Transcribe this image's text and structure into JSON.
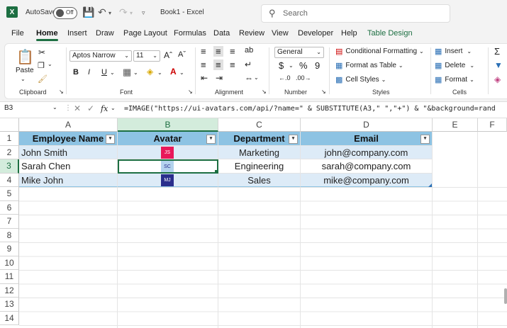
{
  "app": {
    "logo": "X",
    "autosave_label": "AutoSave",
    "autosave_state": "Off",
    "doc_title": "Book1  -  Excel"
  },
  "search": {
    "placeholder": "Search"
  },
  "tabs": [
    "File",
    "Home",
    "Insert",
    "Draw",
    "Page Layout",
    "Formulas",
    "Data",
    "Review",
    "View",
    "Developer",
    "Help",
    "Table Design"
  ],
  "ribbon": {
    "clipboard": {
      "paste_label": "Paste",
      "group_label": "Clipboard"
    },
    "font": {
      "font_name": "Aptos Narrow",
      "font_size": "11",
      "group_label": "Font",
      "bold": "B",
      "italic": "I",
      "underline": "U"
    },
    "alignment": {
      "group_label": "Alignment"
    },
    "number": {
      "format": "General",
      "currency": "$",
      "percent": "%",
      "comma": "9",
      "group_label": "Number"
    },
    "styles": {
      "conditional": "Conditional Formatting",
      "format_table": "Format as Table",
      "cell_styles": "Cell Styles",
      "group_label": "Styles"
    },
    "cells": {
      "insert": "Insert",
      "delete": "Delete",
      "format": "Format",
      "group_label": "Cells"
    }
  },
  "formula_bar": {
    "name_box": "B3",
    "fx": "fx",
    "formula": "=IMAGE(\"https://ui-avatars.com/api/?name=\" & SUBSTITUTE(A3,\" \",\"+\") & \"&background=rand"
  },
  "columns": [
    "A",
    "B",
    "C",
    "D",
    "E",
    "F"
  ],
  "rows": [
    "1",
    "2",
    "3",
    "4",
    "5",
    "6",
    "7",
    "8",
    "9",
    "10",
    "11",
    "12",
    "13",
    "14"
  ],
  "table": {
    "headers": [
      "Employee Name",
      "Avatar",
      "Department",
      "Email"
    ],
    "rows": [
      {
        "name": "John Smith",
        "avatar_initials": "JS",
        "avatar_color": "#e8185a",
        "department": "Marketing",
        "email": "john@company.com"
      },
      {
        "name": "Sarah Chen",
        "avatar_initials": "SC",
        "avatar_color": "#b4d3ee",
        "department": "Engineering",
        "email": "sarah@company.com"
      },
      {
        "name": "Mike John",
        "avatar_initials": "MJ",
        "avatar_color": "#2a2e8c",
        "department": "Sales",
        "email": "mike@company.com"
      }
    ]
  },
  "colors": {
    "accent": "#1d6f42",
    "header_fill": "#8dc3e3",
    "band_fill": "#ddebf7"
  }
}
